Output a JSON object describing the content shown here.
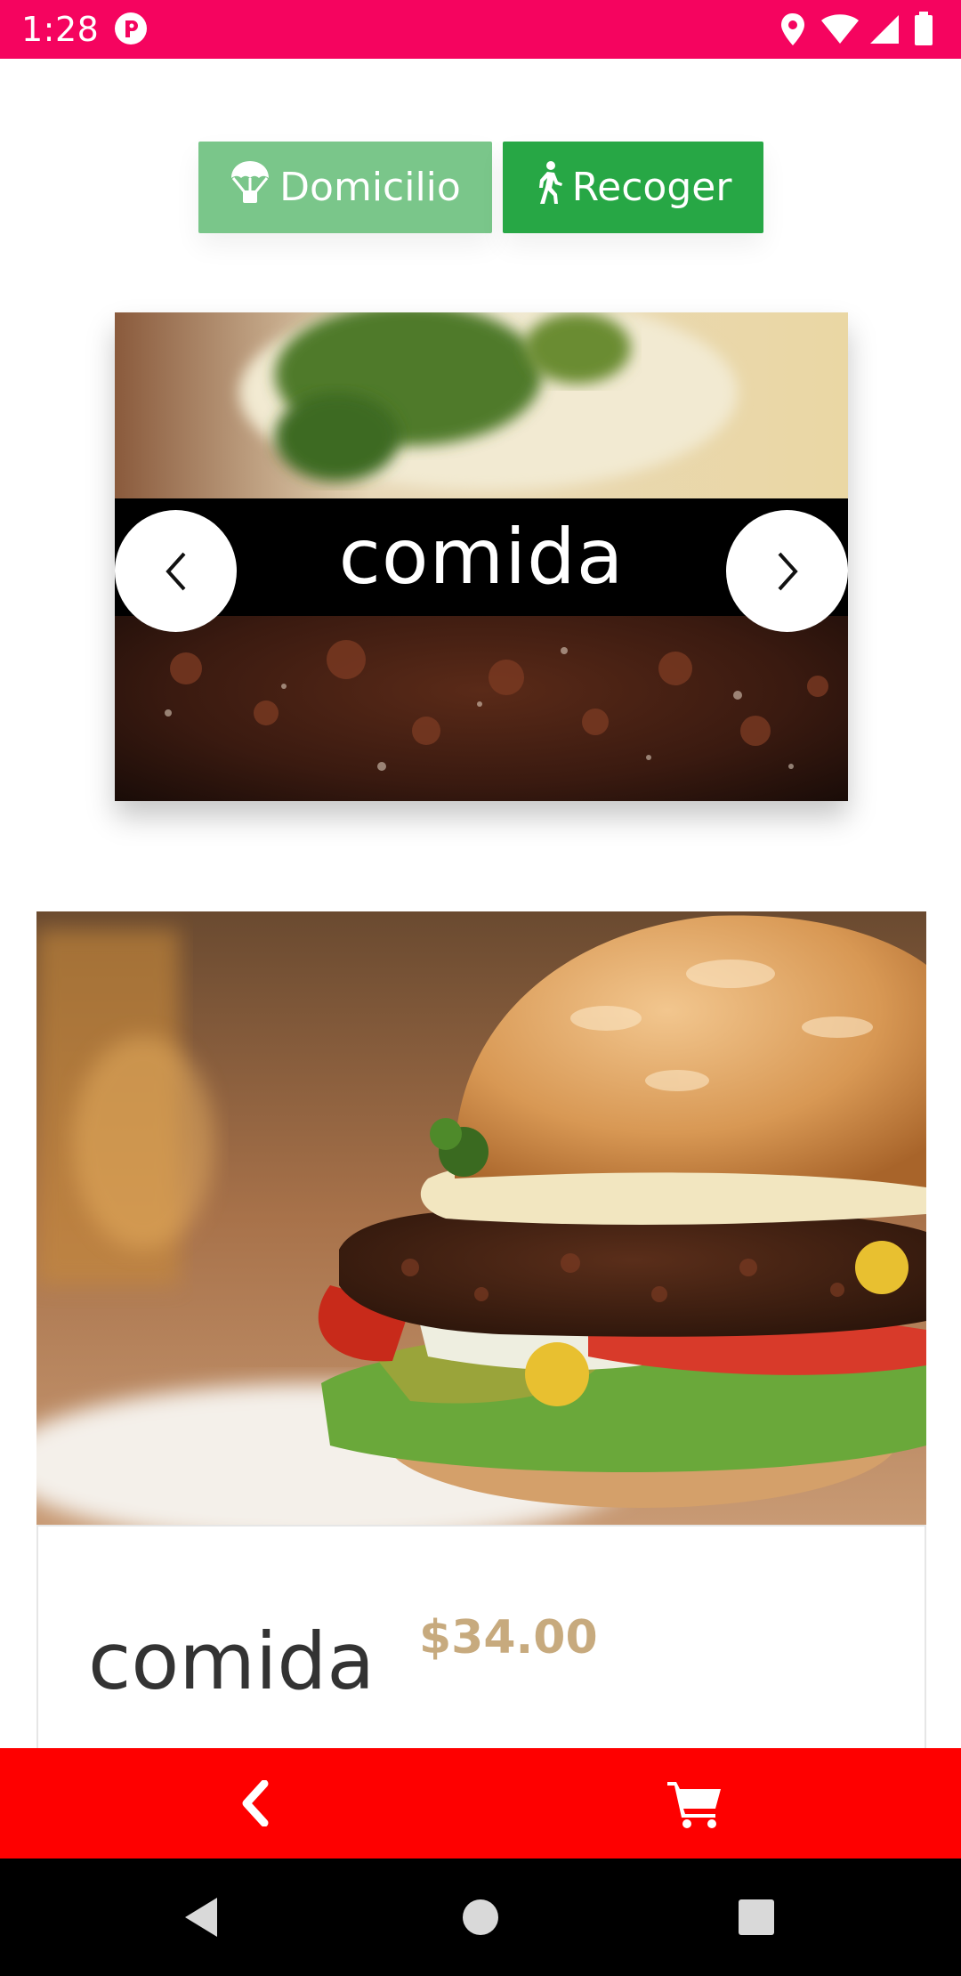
{
  "status_bar": {
    "time": "1:28",
    "background_color": "#f5045f"
  },
  "delivery_modes": {
    "domicilio": {
      "label": "Domicilio",
      "icon": "parachute-icon",
      "color": "#7ac68a",
      "selected": false
    },
    "recoger": {
      "label": "Recoger",
      "icon": "walking-person-icon",
      "color": "#27a745",
      "selected": true
    }
  },
  "category_carousel": {
    "title": "comida",
    "prev_icon": "chevron-left-icon",
    "next_icon": "chevron-right-icon"
  },
  "product": {
    "name": "comida",
    "price": "$34.00",
    "price_color": "#c7aa7e"
  },
  "bottom_bar": {
    "background_color": "#fe0000",
    "back_icon": "chevron-left-icon",
    "cart_icon": "shopping-cart-icon"
  },
  "system_nav": {
    "back_icon": "triangle-back-icon",
    "home_icon": "circle-home-icon",
    "recents_icon": "square-recents-icon"
  }
}
